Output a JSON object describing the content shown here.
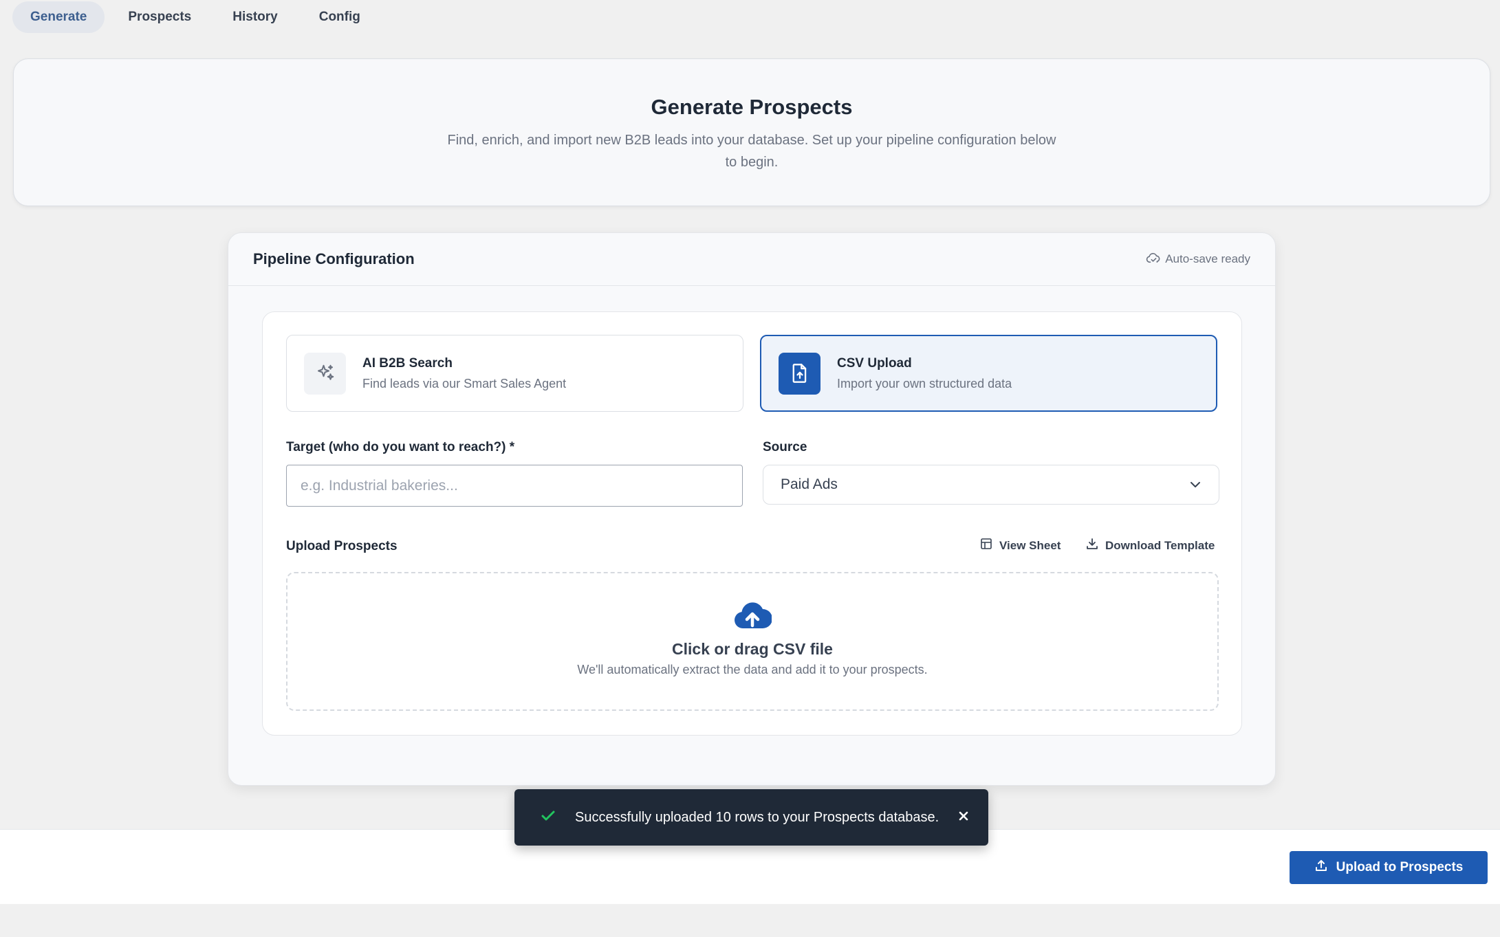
{
  "nav": {
    "tabs": [
      {
        "label": "Generate",
        "active": true
      },
      {
        "label": "Prospects",
        "active": false
      },
      {
        "label": "History",
        "active": false
      },
      {
        "label": "Config",
        "active": false
      }
    ]
  },
  "hero": {
    "title": "Generate Prospects",
    "description": "Find, enrich, and import new B2B leads into your database. Set up your pipeline configuration below to begin."
  },
  "panel": {
    "title": "Pipeline Configuration",
    "autosave": "Auto-save ready",
    "options": [
      {
        "title": "AI B2B Search",
        "subtitle": "Find leads via our Smart Sales Agent",
        "icon": "sparkles-icon",
        "selected": false
      },
      {
        "title": "CSV Upload",
        "subtitle": "Import your own structured data",
        "icon": "file-upload-icon",
        "selected": true
      }
    ],
    "target": {
      "label": "Target (who do you want to reach?) *",
      "placeholder": "e.g. Industrial bakeries...",
      "value": ""
    },
    "source": {
      "label": "Source",
      "value": "Paid Ads"
    },
    "upload": {
      "label": "Upload Prospects",
      "view_sheet": "View Sheet",
      "download_template": "Download Template",
      "dropzone_title": "Click or drag CSV file",
      "dropzone_sub": "We'll automatically extract the data and add it to your prospects."
    }
  },
  "toast": {
    "message": "Successfully uploaded 10 rows to your Prospects database."
  },
  "footer": {
    "upload_button": "Upload to Prospects"
  },
  "colors": {
    "primary": "#1e5bb3",
    "toast_bg": "#1f2937",
    "success": "#22c55e"
  }
}
